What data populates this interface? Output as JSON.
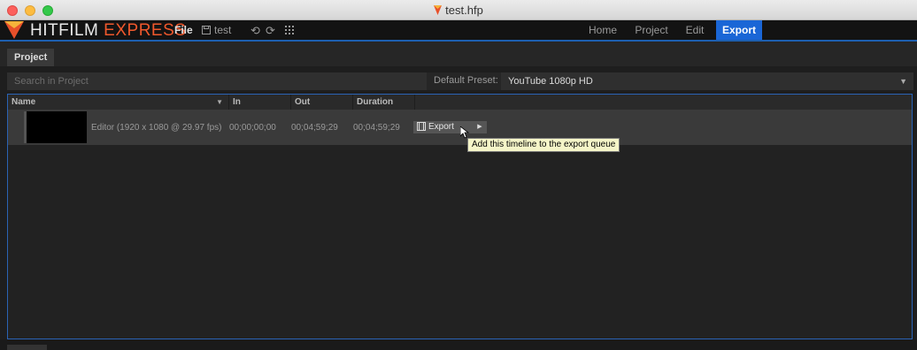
{
  "window": {
    "title": "test.hfp"
  },
  "app": {
    "brand_main": "HITFILM",
    "brand_accent": "EXPRESS",
    "menu_file": "File",
    "project_name": "test",
    "undo_icon": "undo-icon",
    "redo_icon": "redo-icon"
  },
  "nav": {
    "tabs": [
      {
        "label": "Home"
      },
      {
        "label": "Project"
      },
      {
        "label": "Edit"
      },
      {
        "label": "Export",
        "active": true
      }
    ]
  },
  "panel": {
    "tab_label": "Project",
    "search_placeholder": "Search in Project",
    "preset_label": "Default Preset:",
    "preset_value": "YouTube 1080p HD"
  },
  "table": {
    "columns": [
      "Name",
      "In",
      "Out",
      "Duration"
    ],
    "rows": [
      {
        "name": "Editor (1920 x 1080 @ 29.97 fps)",
        "in": "00;00;00;00",
        "out": "00;04;59;29",
        "duration": "00;04;59;29",
        "action_label": "Export"
      }
    ]
  },
  "tooltip": "Add this timeline to the export queue",
  "colors": {
    "accent_blue": "#1a66d6",
    "brand_orange": "#f0582c"
  }
}
